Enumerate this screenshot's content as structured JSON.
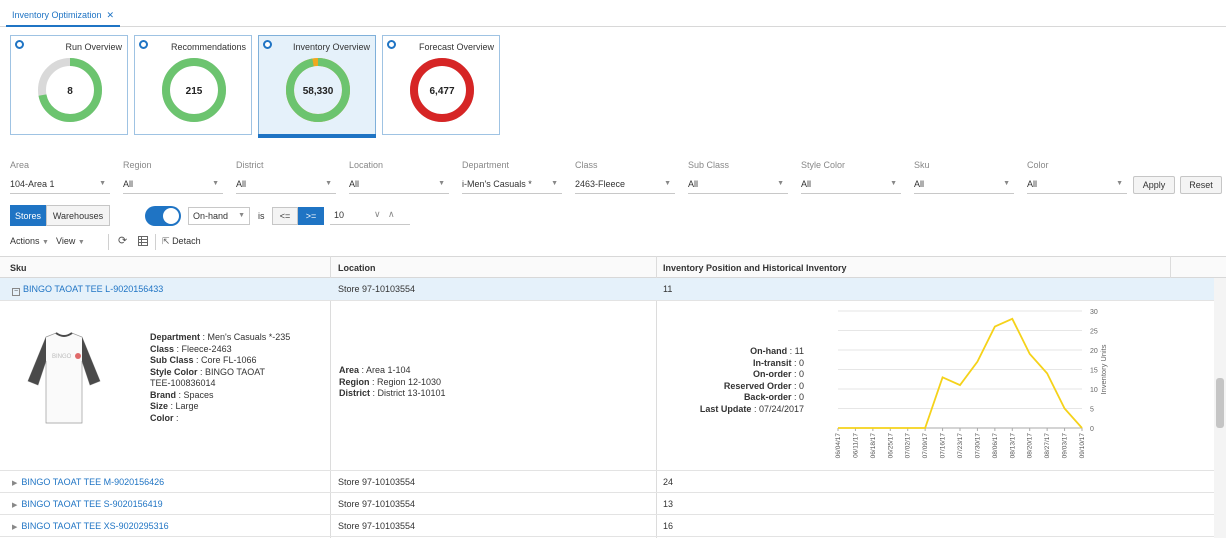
{
  "tab": {
    "label": "Inventory Optimization",
    "close": "✕"
  },
  "tiles": [
    {
      "title": "Run Overview",
      "value": "8",
      "fraction": 0.72,
      "color": "#6cc46f",
      "rest": "#d9d9d9"
    },
    {
      "title": "Recommendations",
      "value": "215",
      "fraction": 1.0,
      "color": "#6cc46f",
      "rest": "#d9d9d9"
    },
    {
      "title": "Inventory Overview",
      "value": "58,330",
      "fraction": 0.97,
      "color": "#6cc46f",
      "rest": "#f0a81e"
    },
    {
      "title": "Forecast Overview",
      "value": "6,477",
      "fraction": 1.0,
      "color": "#d62525",
      "rest": "#d9d9d9"
    }
  ],
  "filters": [
    {
      "label": "Area",
      "value": "104-Area 1"
    },
    {
      "label": "Region",
      "value": "All"
    },
    {
      "label": "District",
      "value": "All"
    },
    {
      "label": "Location",
      "value": "All"
    },
    {
      "label": "Department",
      "value": "i-Men's Casuals *"
    },
    {
      "label": "Class",
      "value": "2463-Fleece"
    },
    {
      "label": "Sub Class",
      "value": "All"
    },
    {
      "label": "Style Color",
      "value": "All"
    },
    {
      "label": "Sku",
      "value": "All"
    },
    {
      "label": "Color",
      "value": "All"
    }
  ],
  "apply_label": "Apply",
  "reset_label": "Reset",
  "view_toggle": {
    "stores": "Stores",
    "warehouses": "Warehouses"
  },
  "condition": {
    "measure": "On-hand",
    "is_label": "is",
    "op_le": "<=",
    "op_ge": ">=",
    "value": "10"
  },
  "actions": {
    "actions_label": "Actions",
    "view_label": "View",
    "detach_label": "Detach"
  },
  "table": {
    "headers": [
      "Sku",
      "Location",
      "Inventory Position and Historical Inventory"
    ],
    "expanded_row": {
      "sku": "BINGO TAOAT TEE L-9020156433",
      "location": "Store 97-10103554",
      "value": "11"
    },
    "product": {
      "lines": [
        {
          "k": "Department",
          "v": "Men's Casuals *-235"
        },
        {
          "k": "Class",
          "v": "Fleece-2463"
        },
        {
          "k": "Sub Class",
          "v": "Core FL-1066"
        },
        {
          "k": "Style Color",
          "v": "BINGO TAOAT"
        },
        {
          "k": "",
          "v": "TEE-100836014"
        },
        {
          "k": "Brand",
          "v": "Spaces"
        },
        {
          "k": "Size",
          "v": "Large"
        },
        {
          "k": "Color",
          "v": ""
        }
      ],
      "shirt_text": "BINGO"
    },
    "location_detail": [
      {
        "k": "Area",
        "v": "Area 1-104"
      },
      {
        "k": "Region",
        "v": "Region 12-1030"
      },
      {
        "k": "District",
        "v": "District 13-10101"
      }
    ],
    "inventory_detail": [
      {
        "k": "On-hand",
        "v": "11"
      },
      {
        "k": "In-transit",
        "v": "0"
      },
      {
        "k": "On-order",
        "v": "0"
      },
      {
        "k": "Reserved Order",
        "v": "0"
      },
      {
        "k": "Back-order",
        "v": "0"
      },
      {
        "k": "Last Update",
        "v": "07/24/2017"
      }
    ],
    "rows": [
      {
        "sku": "BINGO TAOAT TEE M-9020156426",
        "location": "Store 97-10103554",
        "value": "24"
      },
      {
        "sku": "BINGO TAOAT TEE S-9020156419",
        "location": "Store 97-10103554",
        "value": "13"
      },
      {
        "sku": "BINGO TAOAT TEE XS-9020295316",
        "location": "Store 97-10103554",
        "value": "16"
      }
    ]
  },
  "chart_data": {
    "type": "line",
    "x": [
      "06/04/17",
      "06/11/17",
      "06/18/17",
      "06/25/17",
      "07/02/17",
      "07/09/17",
      "07/16/17",
      "07/23/17",
      "07/30/17",
      "08/06/17",
      "08/13/17",
      "08/20/17",
      "08/27/17",
      "09/03/17",
      "09/10/17"
    ],
    "values": [
      0,
      0,
      0,
      0,
      0,
      0,
      13,
      11,
      17,
      26,
      28,
      19,
      14,
      5,
      0
    ],
    "ylabel": "Inventory Units",
    "ylim": [
      0,
      30
    ],
    "yticks": [
      0,
      5,
      10,
      15,
      20,
      25,
      30
    ],
    "color": "#f5d21a",
    "grid": true
  }
}
